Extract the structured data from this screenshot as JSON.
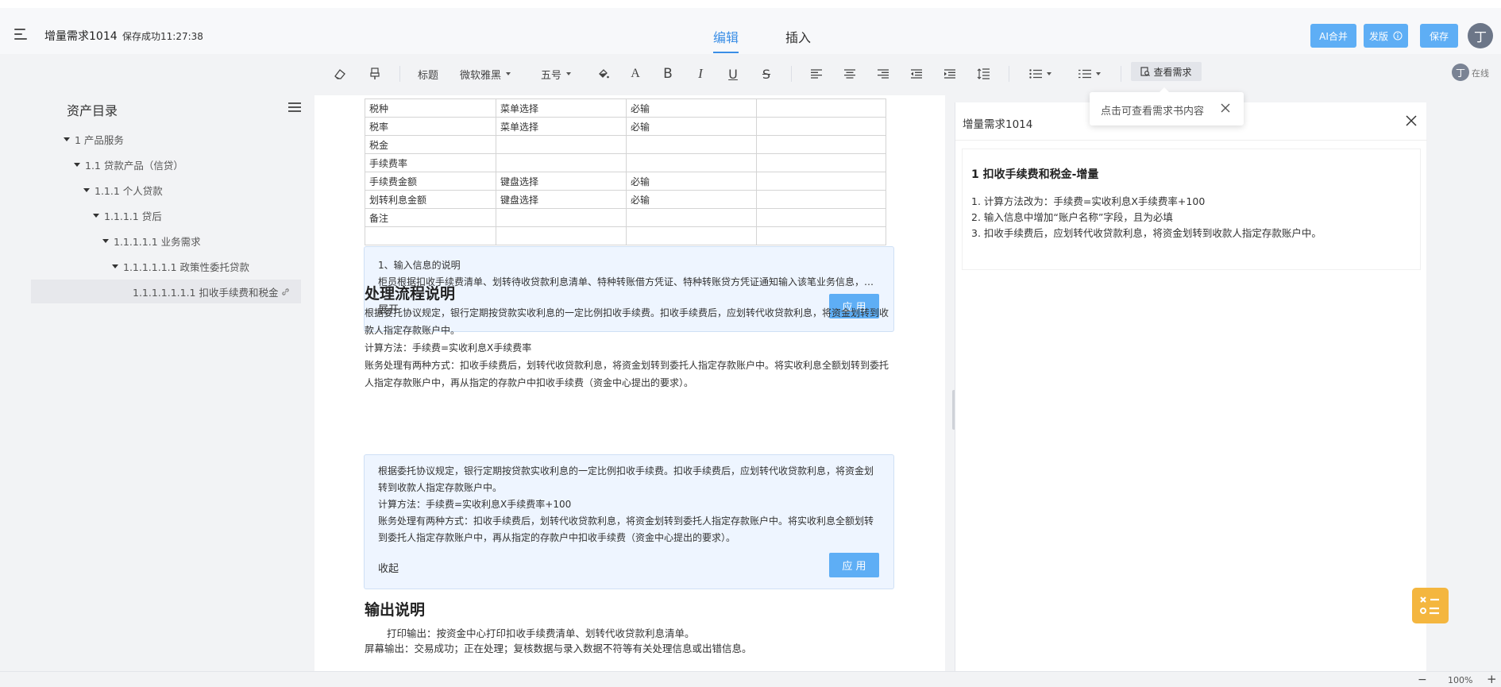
{
  "header": {
    "doc_title": "增量需求1014",
    "save_status": "保存成功11:27:38",
    "tabs": [
      "编辑",
      "插入"
    ],
    "ai_merge": "AI合并",
    "publish": "发版",
    "save": "保存",
    "avatar": "丁"
  },
  "toolbar": {
    "heading": "标题",
    "font": "微软雅黑",
    "size": "五号",
    "view_req": "查看需求",
    "online_avatar": "丁",
    "online": "在线"
  },
  "sidebar": {
    "title": "资产目录",
    "items": [
      "1 产品服务",
      "1.1 贷款产品（信贷）",
      "1.1.1 个人贷款",
      "1.1.1.1 贷后",
      "1.1.1.1.1 业务需求",
      "1.1.1.1.1.1 政策性委托贷款",
      "1.1.1.1.1.1.1 扣收手续费和税金"
    ]
  },
  "doc": {
    "table": [
      [
        "税种",
        "菜单选择",
        "必输",
        ""
      ],
      [
        "税率",
        "菜单选择",
        "必输",
        ""
      ],
      [
        "税金",
        "",
        "",
        ""
      ],
      [
        "手续费率",
        "",
        "",
        ""
      ],
      [
        "手续费金额",
        "键盘选择",
        "必输",
        ""
      ],
      [
        "划转利息金额",
        "键盘选择",
        "必输",
        ""
      ],
      [
        "备注",
        "",
        "",
        ""
      ],
      [
        "",
        "",
        "",
        ""
      ]
    ],
    "card1": {
      "line1": "1、输入信息的说明",
      "line2": "柜员根据扣收手续费清单、划转待收贷款利息清单、特种转账借方凭证、特种转账贷方凭证通知输入该笔业务信息，系统自动完成相关账务处理。",
      "toggle": "展开",
      "apply": "应 用"
    },
    "process_title": "处理流程说明",
    "process_text": "根据委托协议规定，银行定期按贷款实收利息的一定比例扣收手续费。扣收手续费后，应划转代收贷款利息，将资金划转到收款人指定存款账户中。\n计算方法：手续费=实收利息X手续费率\n账务处理有两种方式：扣收手续费后，划转代收贷款利息，将资金划转到委托人指定存款账户中。将实收利息全额划转到委托人指定存款账户中，再从指定的存款户中扣收手续费（资金中心提出的要求）。",
    "card2": {
      "text": "根据委托协议规定，银行定期按贷款实收利息的一定比例扣收手续费。扣收手续费后，应划转代收贷款利息，将资金划转到收款人指定存款账户中。\n计算方法：手续费=实收利息X手续费率+100\n账务处理有两种方式：扣收手续费后，划转代收贷款利息，将资金划转到委托人指定存款账户中。将实收利息全额划转到委托人指定存款账户中，再从指定的存款户中扣收手续费（资金中心提出的要求）。",
      "toggle": "收起",
      "apply": "应 用"
    },
    "output_title": "输出说明",
    "output_line1": "打印输出：按资金中心打印扣收手续费清单、划转代收贷款利息清单。",
    "output_line2": "屏幕输出：交易成功；正在处理；复核数据与录入数据不符等有关处理信息或出错信息。"
  },
  "panel": {
    "title": "增量需求1014",
    "section": "1 扣收手续费和税金-增量",
    "items": [
      "1. 计算方法改为：手续费=实收利息X手续费率+100",
      "2. 输入信息中增加“账户名称”字段，且为必填",
      "3. 扣收手续费后，应划转代收贷款利息，将资金划转到收款人指定存款账户中。"
    ]
  },
  "tooltip": {
    "text": "点击可查看需求书内容"
  },
  "status": {
    "zoom": "100%"
  }
}
